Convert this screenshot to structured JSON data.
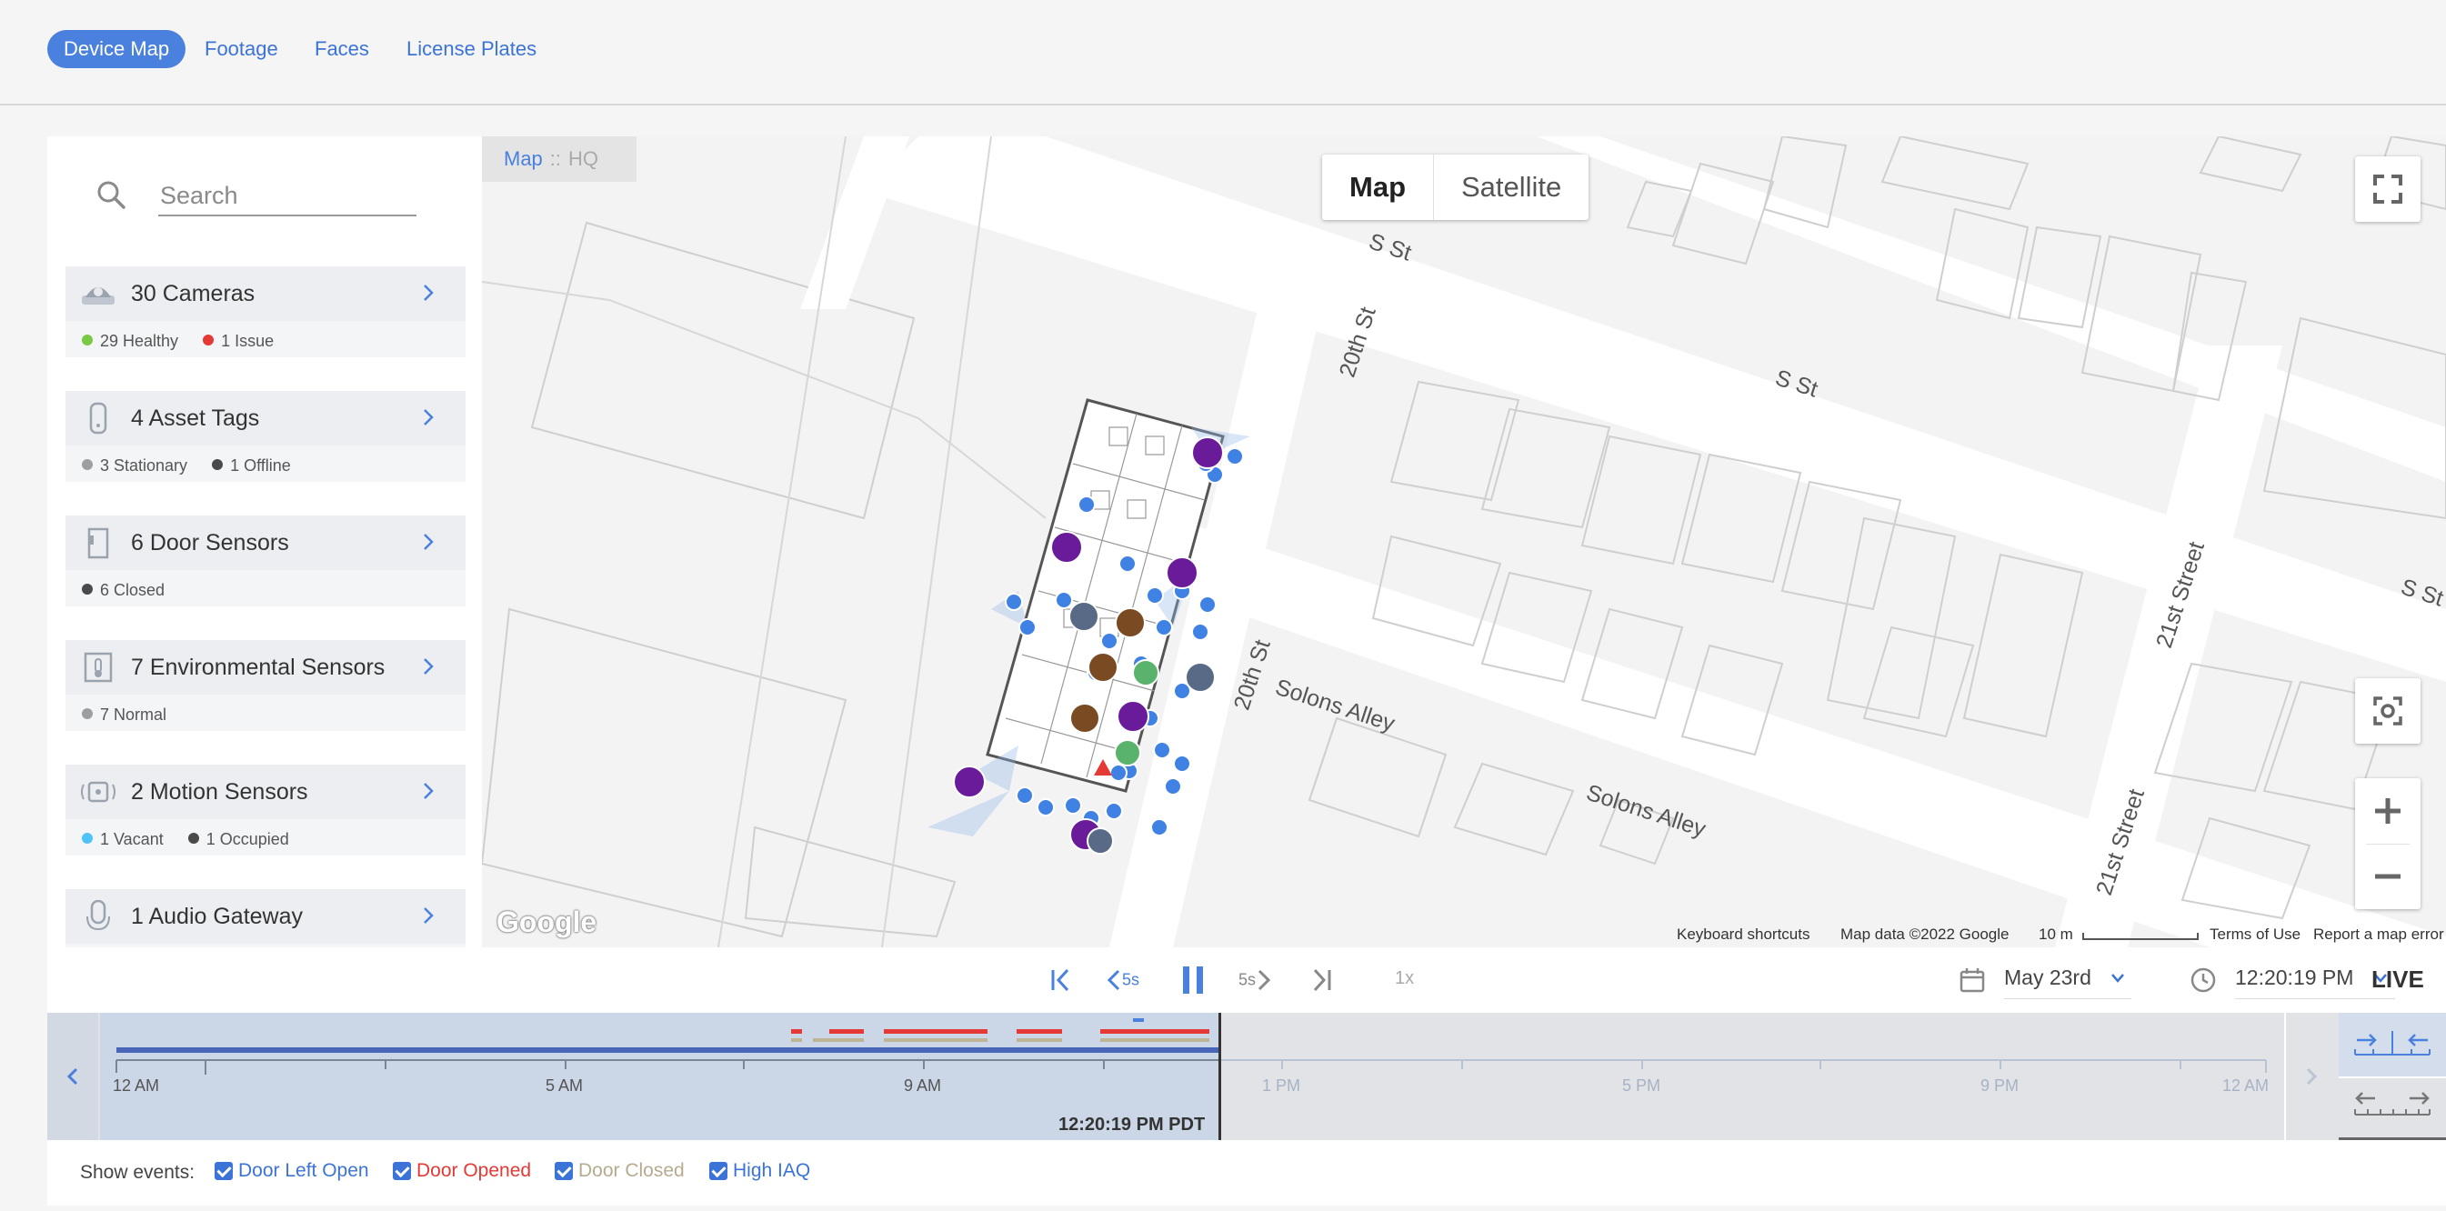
{
  "nav": {
    "tabs": [
      {
        "label": "Device Map",
        "active": true
      },
      {
        "label": "Footage"
      },
      {
        "label": "Faces"
      },
      {
        "label": "License Plates"
      }
    ]
  },
  "sidebar": {
    "search_placeholder": "Search",
    "devices": [
      {
        "label": "30 Cameras",
        "status": [
          {
            "text": "29 Healthy",
            "color": "#7ac943"
          },
          {
            "text": "1 Issue",
            "color": "#e53935"
          }
        ]
      },
      {
        "label": "4 Asset Tags",
        "status": [
          {
            "text": "3 Stationary",
            "color": "#9e9e9e"
          },
          {
            "text": "1 Offline",
            "color": "#4a4a4a"
          }
        ]
      },
      {
        "label": "6 Door Sensors",
        "status": [
          {
            "text": "6 Closed",
            "color": "#4a4a4a"
          }
        ]
      },
      {
        "label": "7 Environmental Sensors",
        "status": [
          {
            "text": "7 Normal",
            "color": "#9e9e9e"
          }
        ]
      },
      {
        "label": "2 Motion Sensors",
        "status": [
          {
            "text": "1 Vacant",
            "color": "#4fc3f7"
          },
          {
            "text": "1 Occupied",
            "color": "#4a4a4a"
          }
        ]
      },
      {
        "label": "1 Audio Gateway",
        "status": []
      }
    ]
  },
  "map": {
    "breadcrumb": {
      "root": "Map",
      "sep": "::",
      "current": "HQ"
    },
    "map_type": {
      "map": "Map",
      "satellite": "Satellite"
    },
    "streets": [
      "S St",
      "S St",
      "S St",
      "20th St",
      "20th St",
      "Solons Alley",
      "Solons Alley",
      "21st Street",
      "21st Street"
    ],
    "attribution": {
      "shortcuts": "Keyboard shortcuts",
      "data": "Map data ©2022 Google",
      "scale": "10 m",
      "terms": "Terms of Use",
      "report": "Report a map error"
    },
    "google_logo": "Google"
  },
  "playback": {
    "skip_back_label": "5s",
    "skip_fwd_label": "5s",
    "speed": "1x",
    "date": "May 23rd",
    "time": "12:20:19 PM",
    "live": "LIVE"
  },
  "timeline": {
    "ticks": [
      {
        "label": "12 AM",
        "future": false
      },
      {
        "label": "5 AM",
        "future": false
      },
      {
        "label": "9 AM",
        "future": false
      },
      {
        "label": "1 PM",
        "future": true
      },
      {
        "label": "5 PM",
        "future": true
      },
      {
        "label": "9 PM",
        "future": true
      },
      {
        "label": "12 AM",
        "future": true
      }
    ],
    "now_label": "12:20:19 PM PDT"
  },
  "events": {
    "title": "Show events:",
    "items": [
      {
        "label": "Door Left Open",
        "color": "#3b74d6"
      },
      {
        "label": "Door Opened",
        "color": "#e53935"
      },
      {
        "label": "Door Closed",
        "color": "#b5ac8f"
      },
      {
        "label": "High IAQ",
        "color": "#3b74d6"
      }
    ]
  }
}
